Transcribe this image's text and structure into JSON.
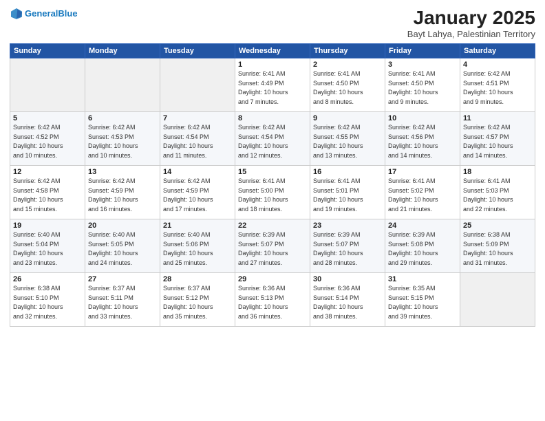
{
  "header": {
    "logo_line1": "General",
    "logo_line2": "Blue",
    "month": "January 2025",
    "location": "Bayt Lahya, Palestinian Territory"
  },
  "weekdays": [
    "Sunday",
    "Monday",
    "Tuesday",
    "Wednesday",
    "Thursday",
    "Friday",
    "Saturday"
  ],
  "weeks": [
    [
      {
        "day": "",
        "info": ""
      },
      {
        "day": "",
        "info": ""
      },
      {
        "day": "",
        "info": ""
      },
      {
        "day": "1",
        "info": "Sunrise: 6:41 AM\nSunset: 4:49 PM\nDaylight: 10 hours\nand 7 minutes."
      },
      {
        "day": "2",
        "info": "Sunrise: 6:41 AM\nSunset: 4:50 PM\nDaylight: 10 hours\nand 8 minutes."
      },
      {
        "day": "3",
        "info": "Sunrise: 6:41 AM\nSunset: 4:50 PM\nDaylight: 10 hours\nand 9 minutes."
      },
      {
        "day": "4",
        "info": "Sunrise: 6:42 AM\nSunset: 4:51 PM\nDaylight: 10 hours\nand 9 minutes."
      }
    ],
    [
      {
        "day": "5",
        "info": "Sunrise: 6:42 AM\nSunset: 4:52 PM\nDaylight: 10 hours\nand 10 minutes."
      },
      {
        "day": "6",
        "info": "Sunrise: 6:42 AM\nSunset: 4:53 PM\nDaylight: 10 hours\nand 10 minutes."
      },
      {
        "day": "7",
        "info": "Sunrise: 6:42 AM\nSunset: 4:54 PM\nDaylight: 10 hours\nand 11 minutes."
      },
      {
        "day": "8",
        "info": "Sunrise: 6:42 AM\nSunset: 4:54 PM\nDaylight: 10 hours\nand 12 minutes."
      },
      {
        "day": "9",
        "info": "Sunrise: 6:42 AM\nSunset: 4:55 PM\nDaylight: 10 hours\nand 13 minutes."
      },
      {
        "day": "10",
        "info": "Sunrise: 6:42 AM\nSunset: 4:56 PM\nDaylight: 10 hours\nand 14 minutes."
      },
      {
        "day": "11",
        "info": "Sunrise: 6:42 AM\nSunset: 4:57 PM\nDaylight: 10 hours\nand 14 minutes."
      }
    ],
    [
      {
        "day": "12",
        "info": "Sunrise: 6:42 AM\nSunset: 4:58 PM\nDaylight: 10 hours\nand 15 minutes."
      },
      {
        "day": "13",
        "info": "Sunrise: 6:42 AM\nSunset: 4:59 PM\nDaylight: 10 hours\nand 16 minutes."
      },
      {
        "day": "14",
        "info": "Sunrise: 6:42 AM\nSunset: 4:59 PM\nDaylight: 10 hours\nand 17 minutes."
      },
      {
        "day": "15",
        "info": "Sunrise: 6:41 AM\nSunset: 5:00 PM\nDaylight: 10 hours\nand 18 minutes."
      },
      {
        "day": "16",
        "info": "Sunrise: 6:41 AM\nSunset: 5:01 PM\nDaylight: 10 hours\nand 19 minutes."
      },
      {
        "day": "17",
        "info": "Sunrise: 6:41 AM\nSunset: 5:02 PM\nDaylight: 10 hours\nand 21 minutes."
      },
      {
        "day": "18",
        "info": "Sunrise: 6:41 AM\nSunset: 5:03 PM\nDaylight: 10 hours\nand 22 minutes."
      }
    ],
    [
      {
        "day": "19",
        "info": "Sunrise: 6:40 AM\nSunset: 5:04 PM\nDaylight: 10 hours\nand 23 minutes."
      },
      {
        "day": "20",
        "info": "Sunrise: 6:40 AM\nSunset: 5:05 PM\nDaylight: 10 hours\nand 24 minutes."
      },
      {
        "day": "21",
        "info": "Sunrise: 6:40 AM\nSunset: 5:06 PM\nDaylight: 10 hours\nand 25 minutes."
      },
      {
        "day": "22",
        "info": "Sunrise: 6:39 AM\nSunset: 5:07 PM\nDaylight: 10 hours\nand 27 minutes."
      },
      {
        "day": "23",
        "info": "Sunrise: 6:39 AM\nSunset: 5:07 PM\nDaylight: 10 hours\nand 28 minutes."
      },
      {
        "day": "24",
        "info": "Sunrise: 6:39 AM\nSunset: 5:08 PM\nDaylight: 10 hours\nand 29 minutes."
      },
      {
        "day": "25",
        "info": "Sunrise: 6:38 AM\nSunset: 5:09 PM\nDaylight: 10 hours\nand 31 minutes."
      }
    ],
    [
      {
        "day": "26",
        "info": "Sunrise: 6:38 AM\nSunset: 5:10 PM\nDaylight: 10 hours\nand 32 minutes."
      },
      {
        "day": "27",
        "info": "Sunrise: 6:37 AM\nSunset: 5:11 PM\nDaylight: 10 hours\nand 33 minutes."
      },
      {
        "day": "28",
        "info": "Sunrise: 6:37 AM\nSunset: 5:12 PM\nDaylight: 10 hours\nand 35 minutes."
      },
      {
        "day": "29",
        "info": "Sunrise: 6:36 AM\nSunset: 5:13 PM\nDaylight: 10 hours\nand 36 minutes."
      },
      {
        "day": "30",
        "info": "Sunrise: 6:36 AM\nSunset: 5:14 PM\nDaylight: 10 hours\nand 38 minutes."
      },
      {
        "day": "31",
        "info": "Sunrise: 6:35 AM\nSunset: 5:15 PM\nDaylight: 10 hours\nand 39 minutes."
      },
      {
        "day": "",
        "info": ""
      }
    ]
  ]
}
